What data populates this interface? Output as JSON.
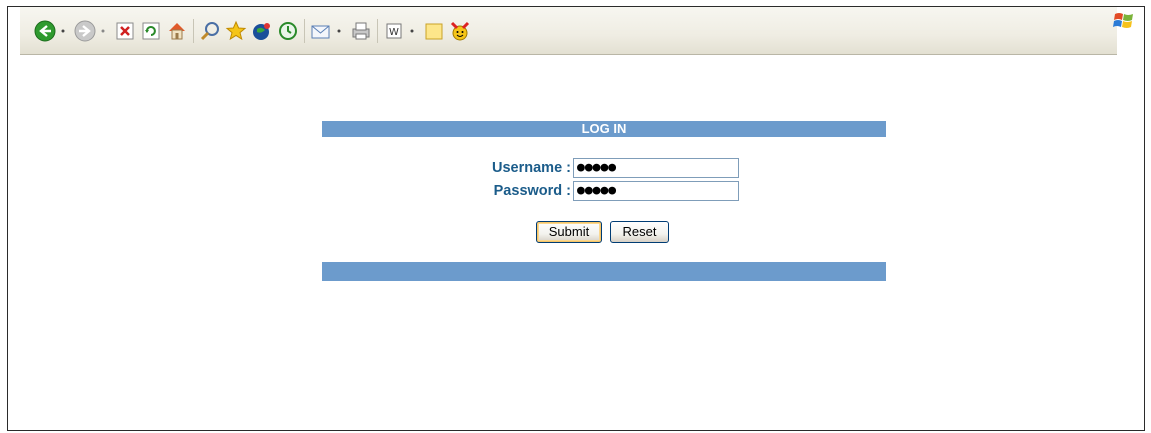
{
  "toolbar": {
    "icons": [
      "back-icon",
      "forward-icon",
      "stop-icon",
      "refresh-icon",
      "home-icon",
      "search-icon",
      "favorites-icon",
      "media-icon",
      "history-icon",
      "mail-icon",
      "print-icon",
      "edit-icon",
      "discuss-icon",
      "messenger-icon"
    ]
  },
  "login": {
    "title": "LOG IN",
    "username_label": "Username :",
    "username_value": "●●●●●",
    "password_label": "Password :",
    "password_value": "●●●●●",
    "submit_label": "Submit",
    "reset_label": "Reset"
  },
  "colors": {
    "bar": "#6c9bcc",
    "label": "#1b5c8a"
  }
}
